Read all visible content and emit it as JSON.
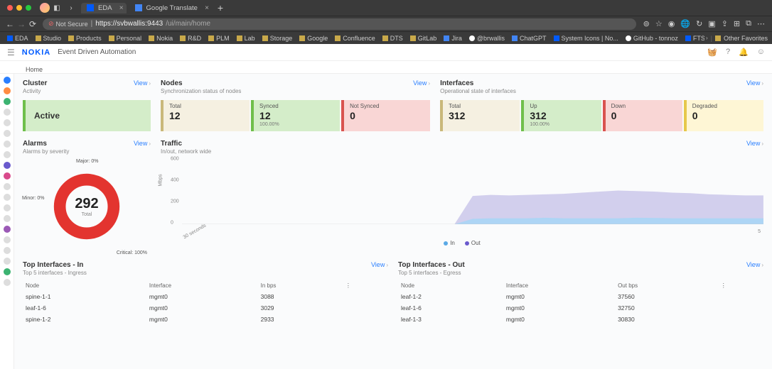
{
  "browser": {
    "tabs": [
      {
        "favicon": "n",
        "title": "EDA"
      },
      {
        "favicon": "blue",
        "title": "Google Translate"
      }
    ],
    "url_security": "Not Secure",
    "url_host": "https://svbwallis:9443",
    "url_path": "/ui/main/home",
    "bookmarks": [
      {
        "type": "n",
        "label": "EDA"
      },
      {
        "type": "folder",
        "label": "Studio"
      },
      {
        "type": "folder",
        "label": "Products"
      },
      {
        "type": "folder",
        "label": "Personal"
      },
      {
        "type": "folder",
        "label": "Nokia"
      },
      {
        "type": "folder",
        "label": "R&D"
      },
      {
        "type": "folder",
        "label": "PLM"
      },
      {
        "type": "folder",
        "label": "Lab"
      },
      {
        "type": "folder",
        "label": "Storage"
      },
      {
        "type": "folder",
        "label": "Google"
      },
      {
        "type": "folder",
        "label": "Confluence"
      },
      {
        "type": "folder",
        "label": "DTS"
      },
      {
        "type": "folder",
        "label": "GitLab"
      },
      {
        "type": "gt",
        "label": "Jira"
      },
      {
        "type": "g",
        "label": "@brwallis"
      },
      {
        "type": "gt",
        "label": "ChatGPT"
      },
      {
        "type": "n",
        "label": "System Icons | No..."
      },
      {
        "type": "g",
        "label": "GitHub - tonnoz"
      },
      {
        "type": "n",
        "label": "FTS - no h/w"
      }
    ],
    "bookmarks_right": "Other Favorites"
  },
  "app": {
    "logo": "NOKIA",
    "title": "Event Driven Automation",
    "breadcrumb": "Home"
  },
  "rail_colors": [
    "#2a7fff",
    "#ff8c42",
    "#3cb371",
    "#ddd",
    "#ddd",
    "#ddd",
    "#ddd",
    "#ddd",
    "#6a5acd",
    "#d94a8c",
    "#ddd",
    "#ddd",
    "#ddd",
    "#ddd",
    "#9b59b6",
    "#ddd",
    "#ddd",
    "#ddd",
    "#3cb371",
    "#ddd"
  ],
  "view_label": "View",
  "cluster": {
    "title": "Cluster",
    "sub": "Activity",
    "status": "Active"
  },
  "nodes": {
    "title": "Nodes",
    "sub": "Synchronization status of nodes",
    "stats": [
      {
        "label": "Total",
        "value": "12",
        "pct": "",
        "style": "s-neutral"
      },
      {
        "label": "Synced",
        "value": "12",
        "pct": "100.00%",
        "style": "s-green"
      },
      {
        "label": "Not Synced",
        "value": "0",
        "pct": "",
        "style": "s-red"
      }
    ]
  },
  "interfaces": {
    "title": "Interfaces",
    "sub": "Operational state of interfaces",
    "stats": [
      {
        "label": "Total",
        "value": "312",
        "pct": "",
        "style": "s-neutral"
      },
      {
        "label": "Up",
        "value": "312",
        "pct": "100.00%",
        "style": "s-green"
      },
      {
        "label": "Down",
        "value": "0",
        "pct": "",
        "style": "s-red"
      },
      {
        "label": "Degraded",
        "value": "0",
        "pct": "",
        "style": "s-yellow"
      }
    ]
  },
  "alarms": {
    "title": "Alarms",
    "sub": "Alarms by severity",
    "total": "292",
    "total_label": "Total",
    "labels": {
      "minor": "Minor: 0%",
      "major": "Major: 0%",
      "critical": "Critical: 100%"
    }
  },
  "traffic": {
    "title": "Traffic",
    "sub": "In/out, network wide",
    "legend": {
      "in": "In",
      "out": "Out"
    }
  },
  "top_in": {
    "title": "Top Interfaces - In",
    "sub": "Top 5 interfaces - Ingress",
    "cols": [
      "Node",
      "Interface",
      "In bps"
    ],
    "rows": [
      [
        "spine-1-1",
        "mgmt0",
        "3088"
      ],
      [
        "leaf-1-6",
        "mgmt0",
        "3029"
      ],
      [
        "spine-1-2",
        "mgmt0",
        "2933"
      ]
    ]
  },
  "top_out": {
    "title": "Top Interfaces - Out",
    "sub": "Top 5 interfaces - Egress",
    "cols": [
      "Node",
      "Interface",
      "Out bps"
    ],
    "rows": [
      [
        "leaf-1-2",
        "mgmt0",
        "37560"
      ],
      [
        "leaf-1-6",
        "mgmt0",
        "32750"
      ],
      [
        "leaf-1-3",
        "mgmt0",
        "30830"
      ]
    ]
  },
  "chart_data": {
    "donut": {
      "type": "pie",
      "title": "Alarms by severity",
      "series": [
        {
          "name": "Critical",
          "value": 292,
          "pct": 100,
          "color": "#e3342f"
        },
        {
          "name": "Major",
          "value": 0,
          "pct": 0,
          "color": "#f6993f"
        },
        {
          "name": "Minor",
          "value": 0,
          "pct": 0,
          "color": "#ffed4a"
        }
      ],
      "total": 292
    },
    "traffic": {
      "type": "area",
      "xlabel": "30 seconds",
      "ylabel": "Mbps",
      "ylim": [
        0,
        600
      ],
      "y_ticks": [
        0,
        200,
        400,
        600
      ],
      "x_ticks": [
        "5"
      ],
      "series": [
        {
          "name": "In",
          "color": "#5aa9e6",
          "values": [
            0,
            0,
            0,
            0,
            0,
            0,
            0,
            0,
            0,
            0,
            0,
            0,
            0,
            0,
            0,
            0,
            50,
            55,
            55,
            55,
            60,
            55,
            55,
            55,
            55,
            60,
            58,
            55,
            55,
            55,
            55,
            55,
            55
          ]
        },
        {
          "name": "Out",
          "color": "#6a5acd",
          "values": [
            0,
            0,
            0,
            0,
            0,
            0,
            0,
            0,
            0,
            0,
            0,
            0,
            0,
            0,
            0,
            0,
            260,
            270,
            265,
            270,
            275,
            280,
            290,
            300,
            310,
            305,
            300,
            290,
            285,
            275,
            270,
            265,
            265
          ]
        }
      ]
    }
  }
}
